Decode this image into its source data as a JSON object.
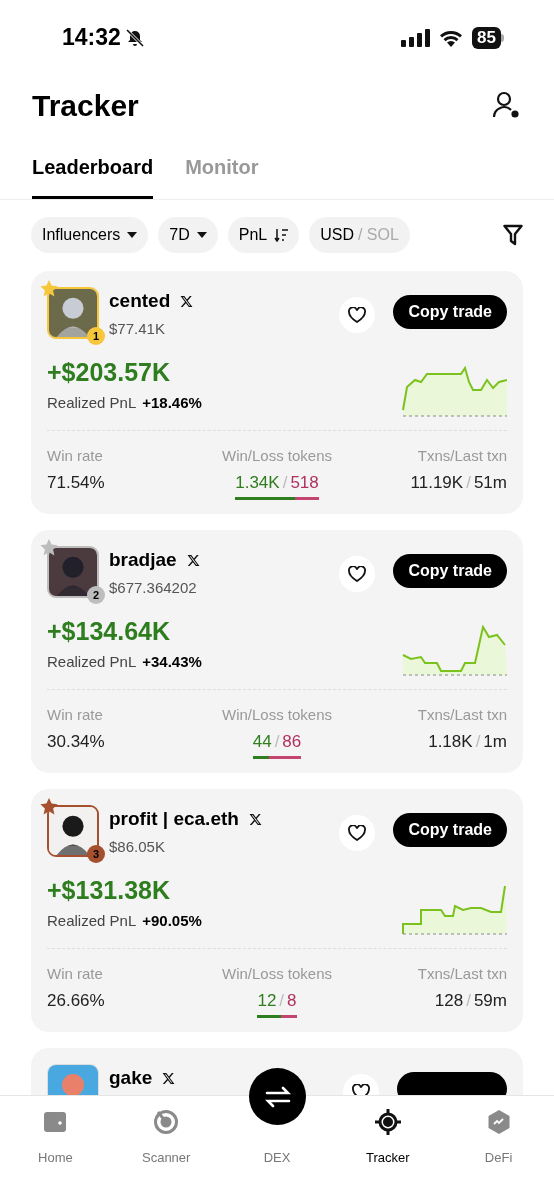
{
  "status_bar": {
    "time": "14:32",
    "battery": "85"
  },
  "header": {
    "title": "Tracker"
  },
  "tabs": [
    {
      "label": "Leaderboard",
      "selected": true
    },
    {
      "label": "Monitor",
      "selected": false
    }
  ],
  "filters": [
    {
      "kind": "dropdown",
      "label": "Influencers"
    },
    {
      "kind": "dropdown",
      "label": "7D"
    },
    {
      "kind": "sort",
      "label": "PnL"
    },
    {
      "kind": "toggle",
      "label": "USD",
      "alt": "/ SOL"
    }
  ],
  "cards": [
    {
      "name": "cented",
      "balance": "$77.41K",
      "rank": "1",
      "color": "#f6c63b",
      "pnl": "+$203.57K",
      "pnl_label": "Realized PnL",
      "pnl_pct": "+18.46%",
      "win_rate_label": "Win rate",
      "win_rate": "71.54%",
      "wl_label": "Win/Loss tokens",
      "wins": "1.34K",
      "losses": "518",
      "level": 0.72,
      "wl_sep": "/",
      "tx_sep": "/",
      "tx_label": "Txns/Last txn",
      "txns": "11.19K",
      "last_txn": "51m",
      "button": "Copy trade"
    },
    {
      "name": "bradjae",
      "balance": "$677.364202",
      "rank": "2",
      "color": "#bdbdbd",
      "pnl": "+$134.64K",
      "pnl_label": "Realized PnL",
      "pnl_pct": "+34.43%",
      "win_rate_label": "Win rate",
      "win_rate": "30.34%",
      "wl_label": "Win/Loss tokens",
      "wins": "44",
      "losses": "86",
      "level": 0.34,
      "wl_sep": "/",
      "tx_sep": "/",
      "tx_label": "Txns/Last txn",
      "txns": "1.18K",
      "last_txn": "1m",
      "button": "Copy trade"
    },
    {
      "name": "profit | eca.eth",
      "balance": "$86.05K",
      "rank": "3",
      "color": "#a5502f",
      "pnl": "+$131.38K",
      "pnl_label": "Realized PnL",
      "pnl_pct": "+90.05%",
      "win_rate_label": "Win rate",
      "win_rate": "26.66%",
      "wl_label": "Win/Loss tokens",
      "wins": "12",
      "losses": "8",
      "level": 0.6,
      "wl_sep": "/",
      "tx_sep": "/",
      "tx_label": "Txns/Last txn",
      "txns": "128",
      "last_txn": "59m",
      "button": "Copy trade"
    },
    {
      "name": "gake"
    }
  ],
  "nav": [
    {
      "label": "Home",
      "selected": false
    },
    {
      "label": "Scanner",
      "selected": false
    },
    {
      "label": "DEX",
      "selected": false
    },
    {
      "label": "Tracker",
      "selected": true
    },
    {
      "label": "DeFi",
      "selected": false
    }
  ]
}
